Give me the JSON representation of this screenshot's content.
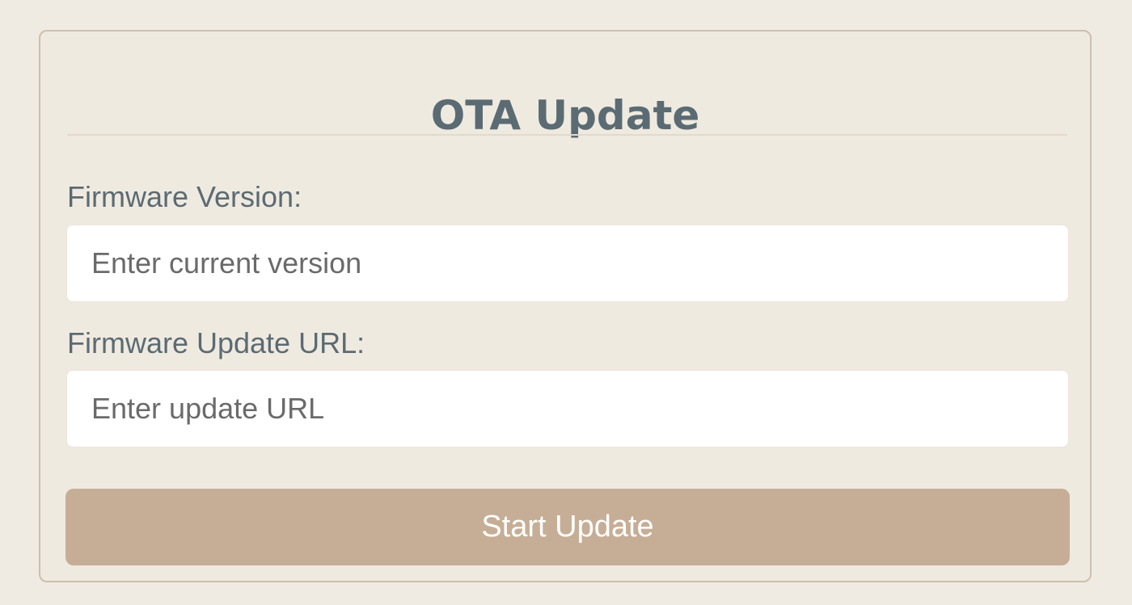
{
  "form": {
    "title": "OTA Update",
    "version_label": "Firmware Version:",
    "version_placeholder": "Enter current version",
    "version_value": "",
    "url_label": "Firmware Update URL:",
    "url_placeholder": "Enter update URL",
    "url_value": "",
    "submit_label": "Start Update"
  },
  "colors": {
    "background": "#f0ebe2",
    "card_border": "#cdbfae",
    "text": "#5b6b73",
    "input_background": "#ffffff",
    "button": "#c6ae96",
    "button_text": "#ffffff"
  }
}
